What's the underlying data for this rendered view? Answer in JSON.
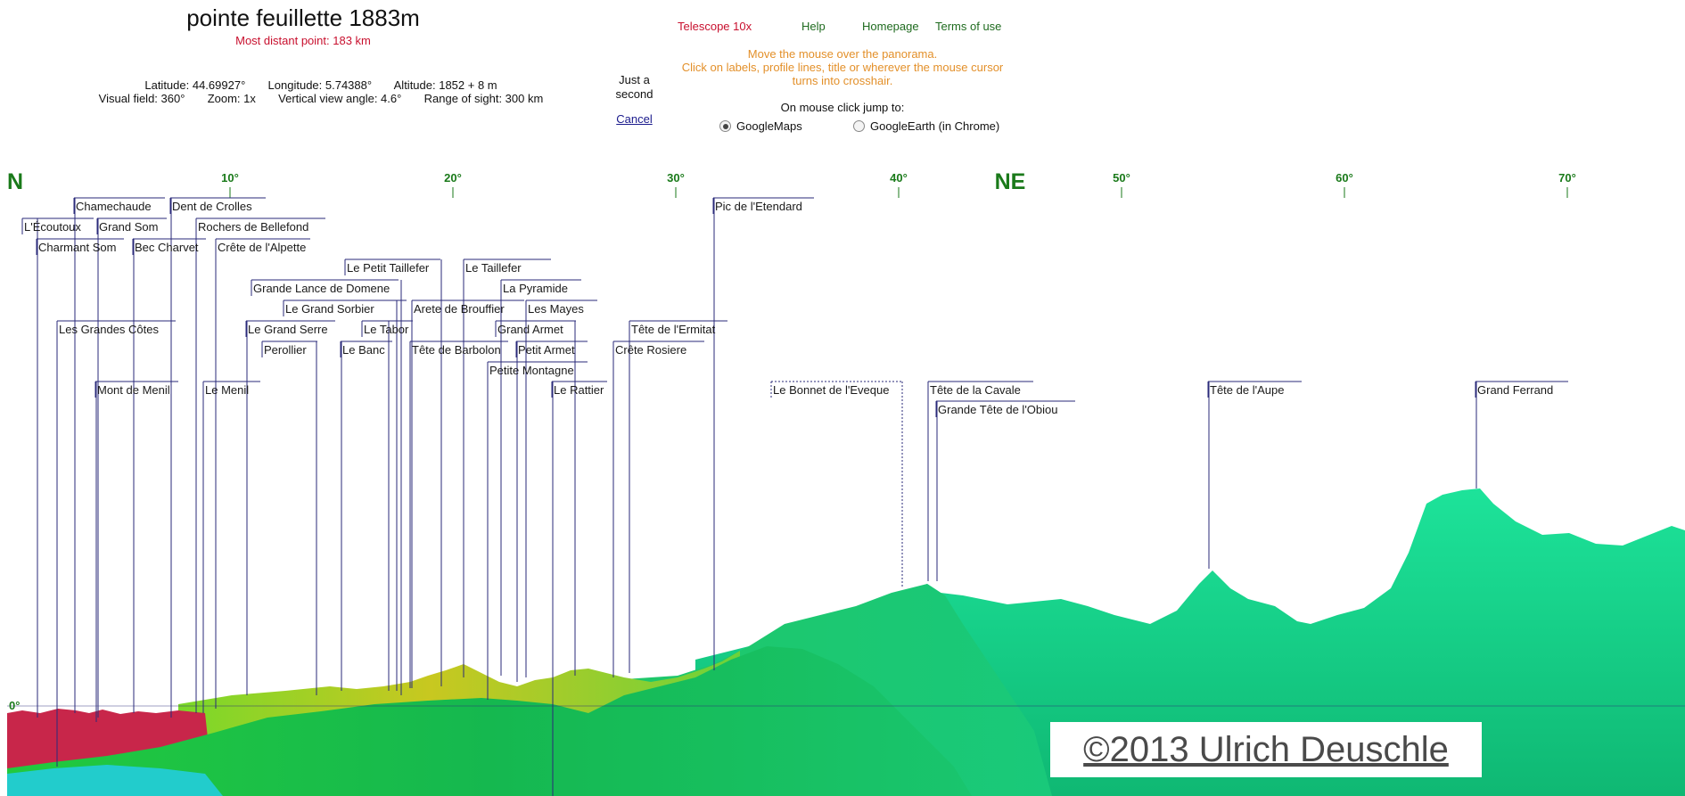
{
  "header": {
    "title": "pointe feuillette 1883m",
    "distant_point": "Most distant point: 183 km",
    "info_line1": "Latitude: 44.69927°       Longitude: 5.74388°       Altitude: 1852 + 8 m",
    "info_line2": "Visual field: 360°       Zoom: 1x       Vertical view angle: 4.6°       Range of sight: 300 km",
    "wait_line1": "Just a",
    "wait_line2": "second",
    "cancel": "Cancel"
  },
  "nav": {
    "telescope": "Telescope 10x",
    "help": "Help",
    "homepage": "Homepage",
    "terms": "Terms of use",
    "telescope_color": "#c8102e",
    "link_color": "#1f6b1f"
  },
  "hint": {
    "line1": "Move the mouse over the panorama.",
    "line2": "Click on labels, profile lines, title or wherever the mouse cursor",
    "line3": "turns into crosshair."
  },
  "jump": {
    "label": "On mouse click jump to:",
    "option1": "GoogleMaps",
    "option2": "GoogleEarth (in Chrome)",
    "selected": "GoogleMaps"
  },
  "panorama": {
    "cardinals": [
      "N",
      "NE"
    ],
    "degree_ticks": [
      "10°",
      "20°",
      "30°",
      "40°",
      "50°",
      "60°",
      "70°"
    ],
    "horizon_label": "0°",
    "peaks": [
      "Chamechaude",
      "Dent de Crolles",
      "L'Écoutoux",
      "Grand Som",
      "Rochers de Bellefond",
      "Charmant Som",
      "Bec Charvet",
      "Crête de l'Alpette",
      "Pic de l'Etendard",
      "Le Petit Taillefer",
      "Le Taillefer",
      "Grande Lance de Domene",
      "La Pyramide",
      "Le Grand Sorbier",
      "Arete de Brouffier",
      "Les Mayes",
      "Les Grandes Côtes",
      "Le Grand Serre",
      "Le Tabor",
      "Grand Armet",
      "Tête de l'Ermitat",
      "Perollier",
      "Le Banc",
      "Tête de Barbolon",
      "Petit Armet",
      "Crête Rosiere",
      "Petite Montagne",
      "Mont de Menil",
      "Le Menil",
      "Le Rattier",
      "Le Bonnet de l'Eveque",
      "Tête de la Cavale",
      "Grande Tête de l'Obiou",
      "Tête de l'Aupe",
      "Grand Ferrand"
    ],
    "colors": {
      "label_line": "#2a2a7a",
      "degree_text": "#1a7a1a",
      "terrain_far": "#1de39a",
      "terrain_mid": "#19d873",
      "terrain_green": "#2fcf4d",
      "terrain_yellow": "#c8c820",
      "terrain_red": "#c8102e",
      "water": "#22cccc"
    }
  },
  "watermark": "©2013 Ulrich Deuschle"
}
